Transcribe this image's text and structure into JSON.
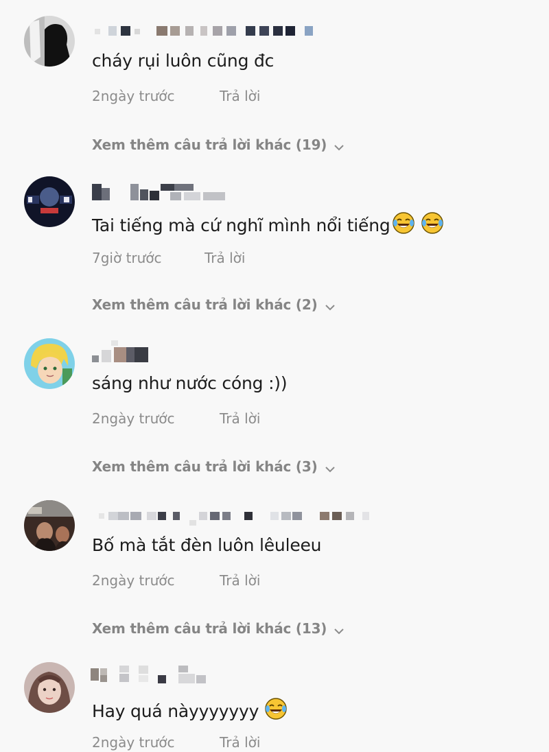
{
  "comments": [
    {
      "text": "cháy rụi luôn cũng đc",
      "emojis": [],
      "time": "2ngày trước",
      "reply_label": "Trả lời",
      "more_replies": "Xem thêm câu trả lời khác (19)"
    },
    {
      "text": "Tai tiếng mà cứ nghĩ mình nổi tiếng",
      "emojis": [
        "tears-of-joy",
        "tears-of-joy"
      ],
      "time": "7giờ trước",
      "reply_label": "Trả lời",
      "more_replies": "Xem thêm câu trả lời khác (2)"
    },
    {
      "text": "sáng như nước cóng :))",
      "emojis": [],
      "time": "2ngày trước",
      "reply_label": "Trả lời",
      "more_replies": "Xem thêm câu trả lời khác (3)"
    },
    {
      "text": "Bố mà tắt đèn luôn lêuleeu",
      "emojis": [],
      "time": "2ngày trước",
      "reply_label": "Trả lời",
      "more_replies": "Xem thêm câu trả lời khác (13)"
    },
    {
      "text": "Hay quá nàyyyyyyy",
      "emojis": [
        "tears-of-joy"
      ],
      "time": "2ngày trước",
      "reply_label": "Trả lời"
    }
  ],
  "colors": {
    "background": "#f8f8f8",
    "text": "#1c1c1c",
    "meta": "#8b8b8b",
    "emoji_face": "#f7c533"
  }
}
